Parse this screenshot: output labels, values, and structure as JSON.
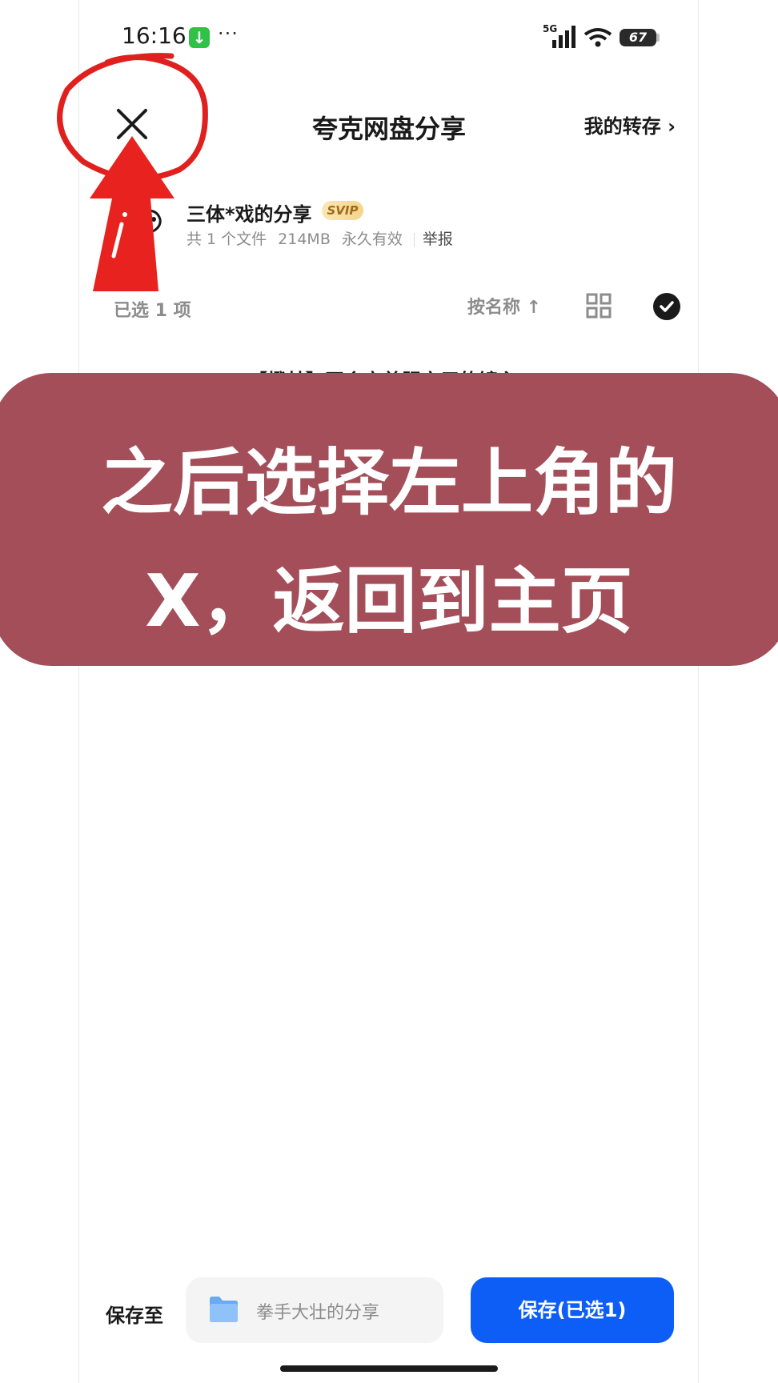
{
  "status_bar": {
    "time": "16:16",
    "dots": "···",
    "network": "5G",
    "battery": "67"
  },
  "header": {
    "title": "夸克网盘分享",
    "my_saves_link": "我的转存 ›",
    "close_icon": "close-icon"
  },
  "sharer": {
    "name": "三体*戏的分享",
    "badge": "SVIP",
    "file_count": "共 1 个文件",
    "size": "214MB",
    "validity": "永久有效",
    "report": "举报"
  },
  "toolbar": {
    "selected": "已选 1 项",
    "sort": "按名称 ↑",
    "grid_icon": "grid-view-icon",
    "check_icon": "select-all-check-icon"
  },
  "files": [
    {
      "name": "11.21【橙林】开会宠着服宠用的镜主"
    }
  ],
  "annotation": {
    "line1": "之后选择左上角的",
    "line2": "X，返回到主页",
    "color": "#a34e58",
    "marker_color": "#e0201e"
  },
  "bottom_bar": {
    "save_to_label": "保存至",
    "folder_name": "拳手大壮的分享",
    "save_button": "保存(已选1)",
    "accent": "#0d5ef7"
  }
}
